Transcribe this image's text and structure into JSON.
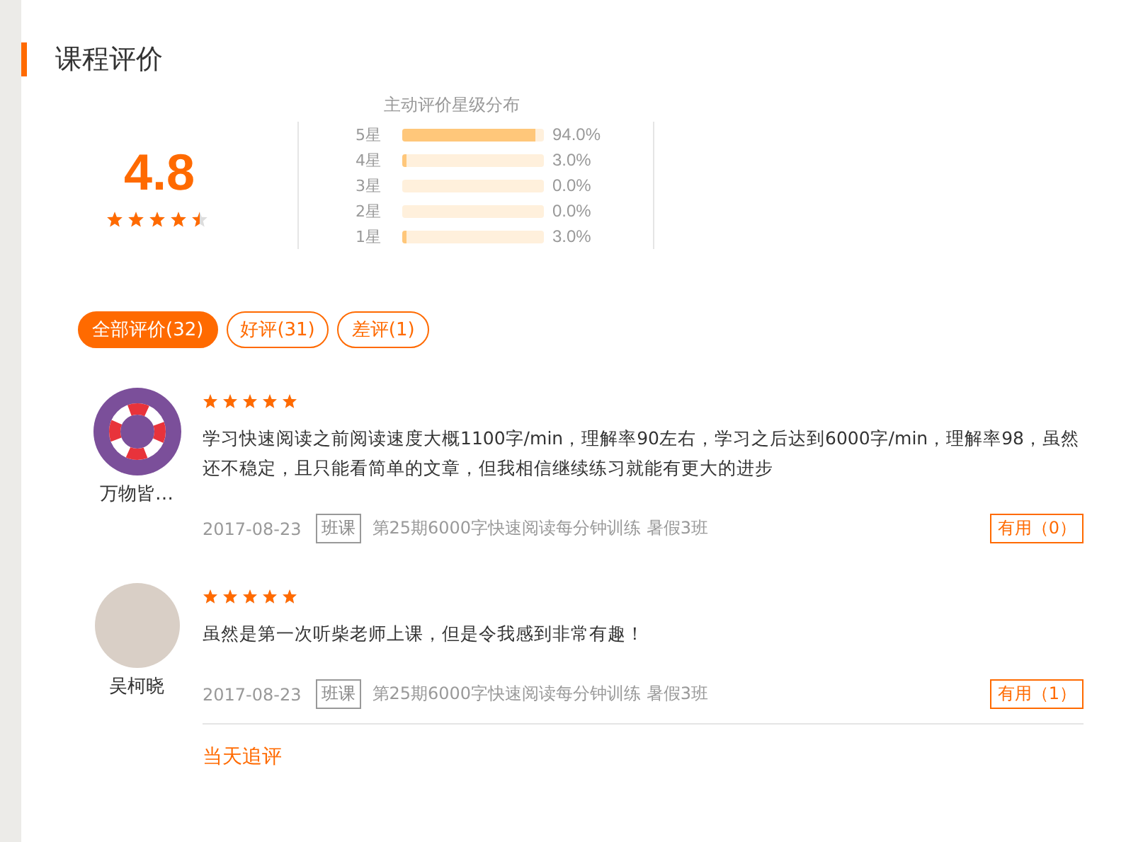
{
  "section_title": "课程评价",
  "summary": {
    "score": "4.8",
    "stars": 4.5,
    "distribution_title": "主动评价星级分布",
    "rows": [
      {
        "label": "5星",
        "level": 0.94,
        "percent": "94.0%"
      },
      {
        "label": "4星",
        "level": 0.03,
        "percent": "3.0%"
      },
      {
        "label": "3星",
        "level": 0,
        "percent": "0.0%"
      },
      {
        "label": "2星",
        "level": 0,
        "percent": "0.0%"
      },
      {
        "label": "1星",
        "level": 0.03,
        "percent": "3.0%"
      }
    ]
  },
  "filters": [
    {
      "label": "全部评价(32)",
      "selected": true
    },
    {
      "label": "好评(31)",
      "selected": false
    },
    {
      "label": "差评(1)",
      "selected": false
    }
  ],
  "reviews": [
    {
      "name": "万物皆…",
      "kind": "lifebuoy",
      "stars": 5,
      "text": "学习快速阅读之前阅读速度大概1100字/min，理解率90左右，学习之后达到6000字/min，理解率98，虽然还不稳定，且只能看简单的文章，但我相信继续练习就能有更大的进步",
      "date": "2017-08-23",
      "tag": "班课",
      "course": "第25期6000字快速阅读每分钟训练 暑假3班",
      "useful": "有用（0）"
    },
    {
      "name": "吴柯晓",
      "kind": "photo",
      "stars": 5,
      "text": "虽然是第一次听柴老师上课，但是令我感到非常有趣！",
      "date": "2017-08-23",
      "tag": "班课",
      "course": "第25期6000字快速阅读每分钟训练 暑假3班",
      "useful": "有用（1）",
      "followup_title": "当天追评"
    }
  ]
}
